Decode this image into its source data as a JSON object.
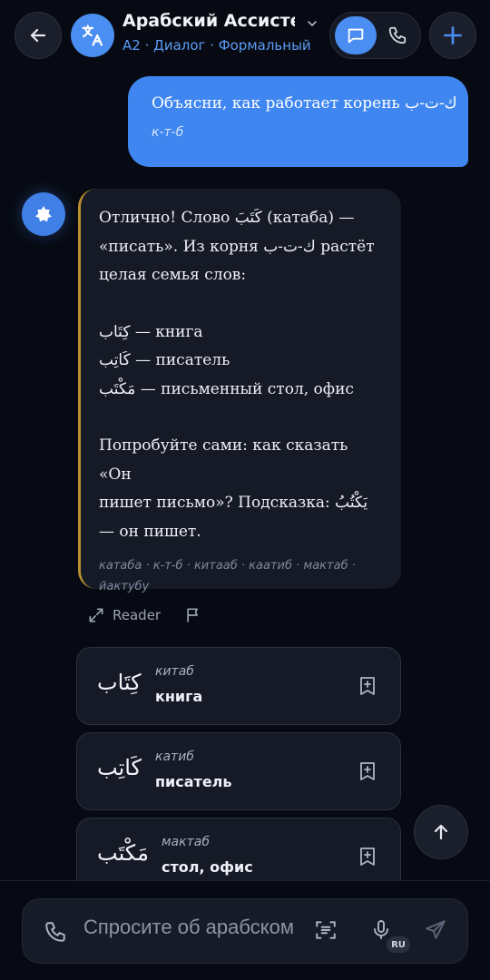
{
  "header": {
    "title": "Арабский Ассистент",
    "subtitle": "A2 · Диалог · Формальный"
  },
  "user_message": {
    "text": "Объясни, как работает корень ك-ت-ب",
    "transliteration": "к-т-б"
  },
  "assistant_message": {
    "lines": [
      "Отлично! Слово كَتَبَ (катаба) —",
      "«писать». Из корня ك-ت-ب растёт",
      "целая семья слов:",
      "",
      "كِتَاب — книга",
      "كَاتِب — писатель",
      "مَكْتَب — письменный стол, офис",
      "",
      "Попробуйте сами: как сказать «Он",
      "пишет письмо»? Подсказка: يَكْتُبُ",
      "— он пишет."
    ],
    "tags_line1": "катаба · к-т-б · китааб · каатиб · мактаб ·",
    "tags_line2": "йактубу",
    "reader_label": "Reader"
  },
  "word_cards": [
    {
      "arabic": "كِتَاب",
      "translit": "китаб",
      "meaning": "книга"
    },
    {
      "arabic": "كَاتِب",
      "translit": "катиб",
      "meaning": "писатель"
    },
    {
      "arabic": "مَكْتَب",
      "translit": "мактаб",
      "meaning": "стол, офис"
    }
  ],
  "input": {
    "placeholder": "Спросите об арабском",
    "language_badge": "RU"
  },
  "colors": {
    "accent": "#4a8ef2",
    "user_bubble": "#3f86f0",
    "assistant_border": "#b8902e",
    "background": "#070a12"
  }
}
